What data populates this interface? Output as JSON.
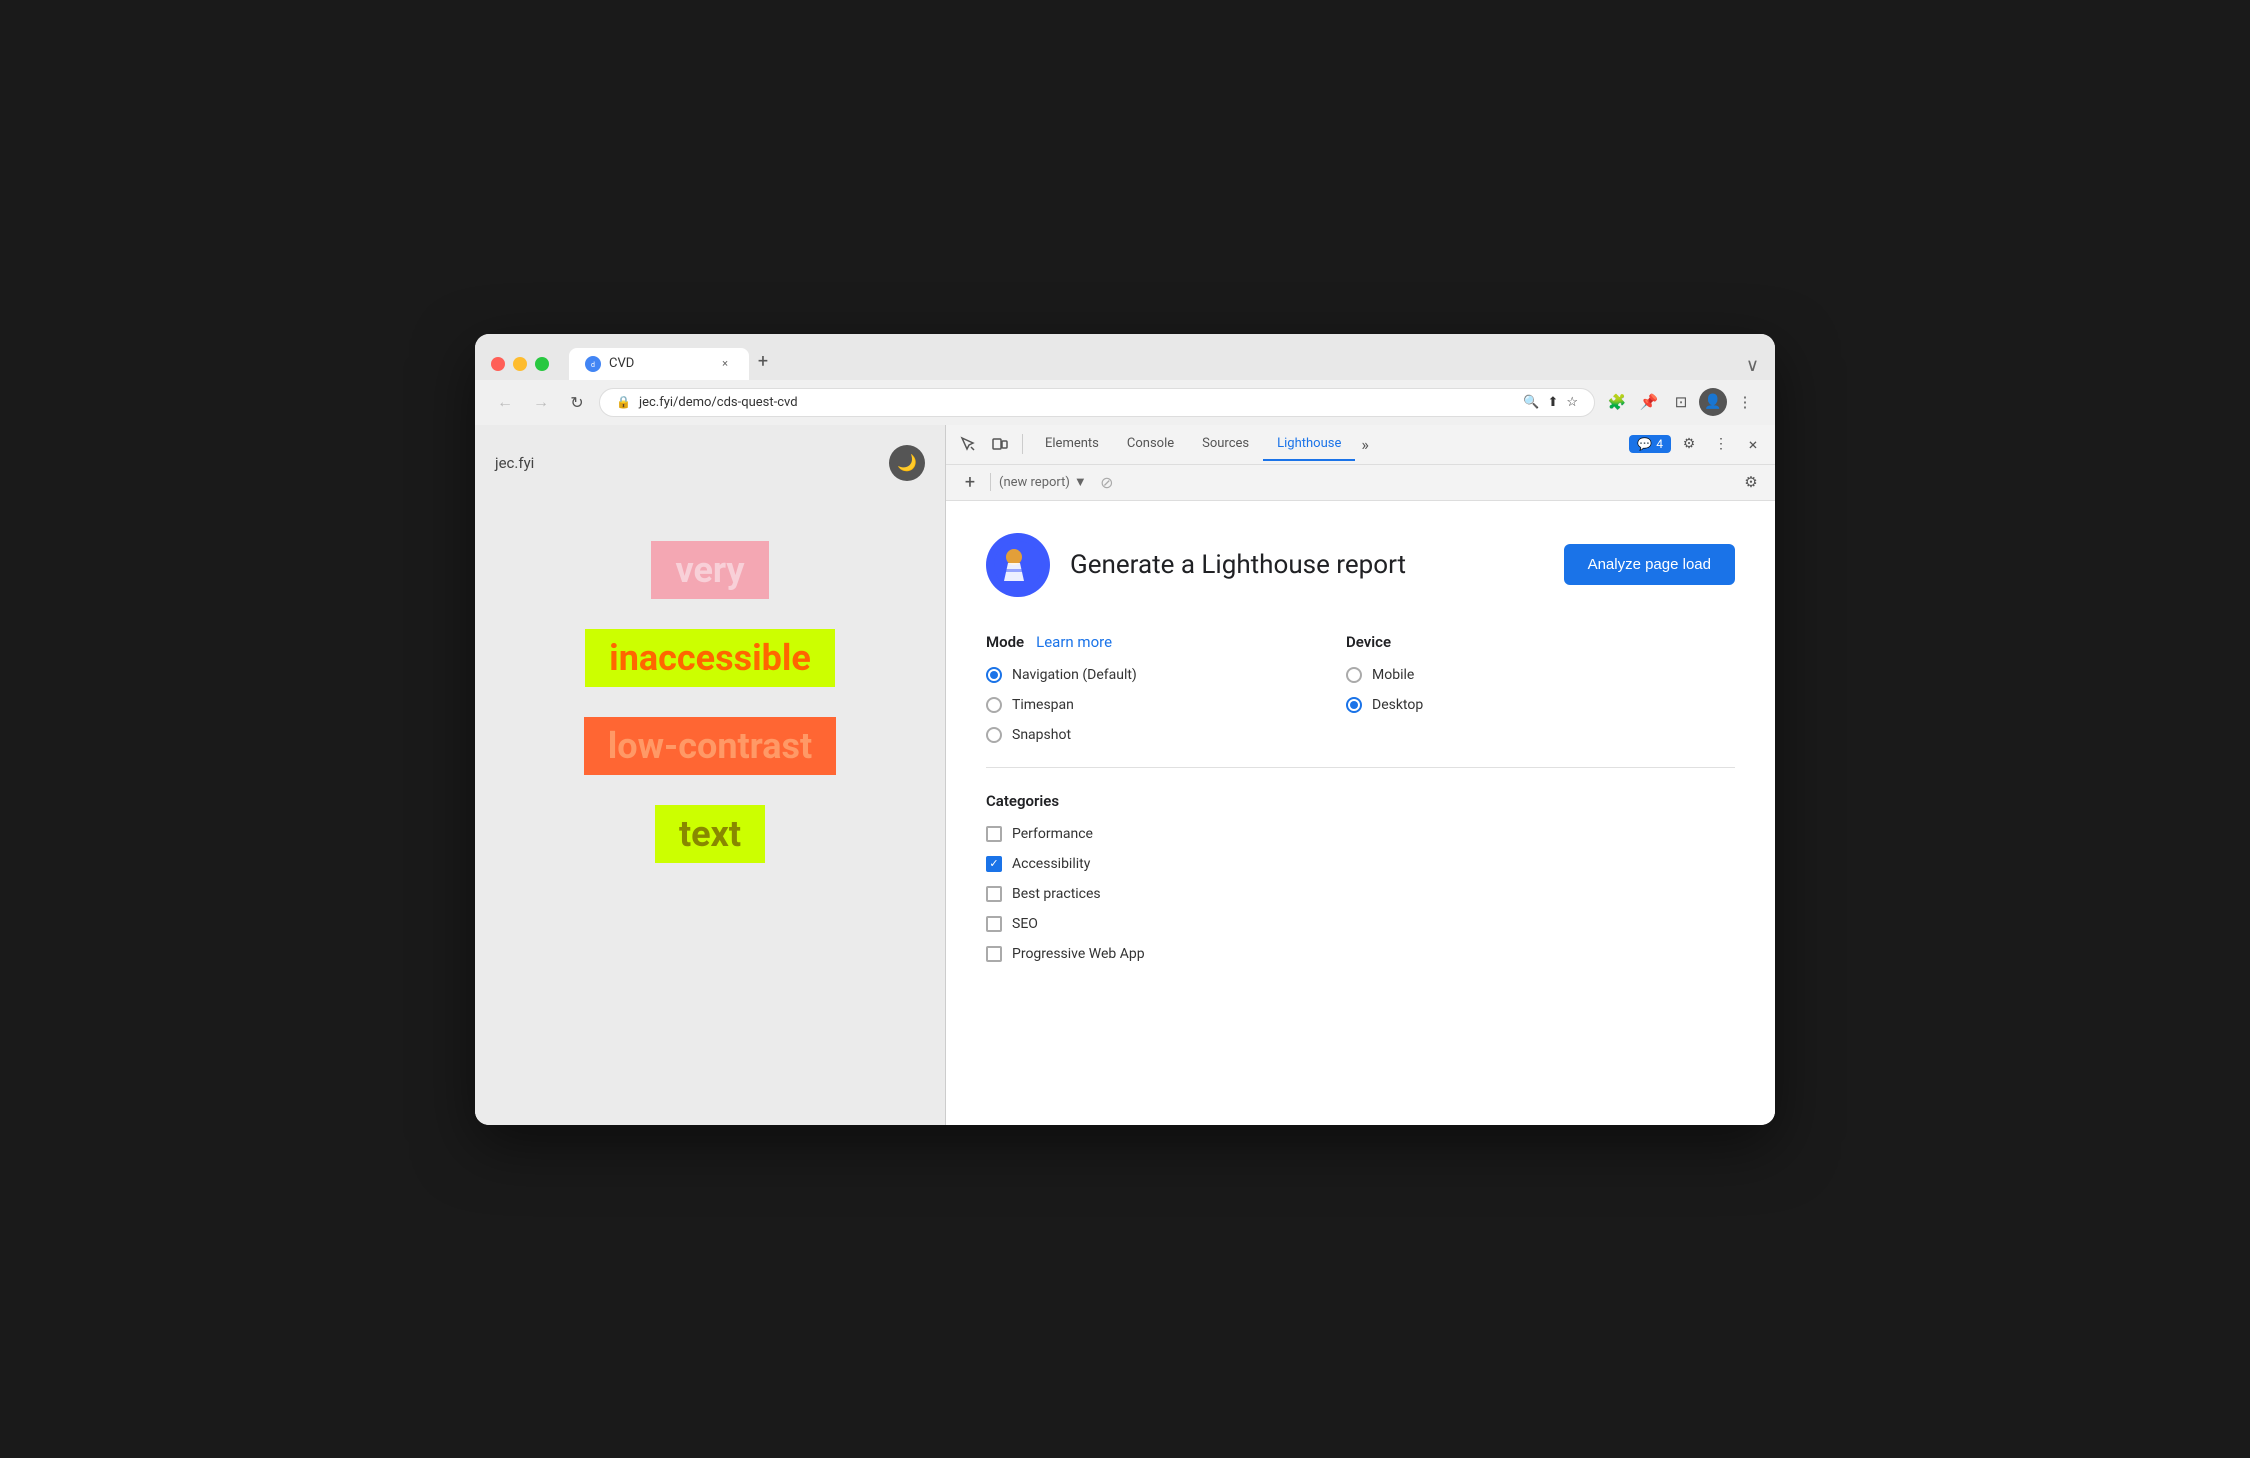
{
  "browser": {
    "tab_title": "CVD",
    "tab_close": "×",
    "new_tab": "+",
    "window_controls_end": "∨",
    "address": "jec.fyi/demo/cds-quest-cvd",
    "back_disabled": true,
    "forward_disabled": true
  },
  "webpage": {
    "logo": "jec.fyi",
    "dark_mode_icon": "🌙",
    "words": [
      {
        "text": "very",
        "bg": "#f4a7b3",
        "color": "#f8c8d0"
      },
      {
        "text": "inaccessible",
        "bg": "#ccff00",
        "color": "#ff6600"
      },
      {
        "text": "low-contrast",
        "bg": "#ff6633",
        "color": "#ff9966"
      },
      {
        "text": "text",
        "bg": "#ccff00",
        "color": "#888800"
      }
    ]
  },
  "devtools": {
    "tabs": [
      {
        "label": "Elements"
      },
      {
        "label": "Console"
      },
      {
        "label": "Sources"
      },
      {
        "label": "Lighthouse",
        "active": true
      }
    ],
    "more_tabs": "»",
    "badge_count": "4",
    "settings_icon": "⚙",
    "more_options": "⋮",
    "close": "×",
    "inspect_icon": "⬚",
    "device_icon": "⊡"
  },
  "lighthouse": {
    "subtoolbar": {
      "add": "+",
      "report_placeholder": "(new report)",
      "dropdown": "▼",
      "block": "⊘",
      "settings": "⚙"
    },
    "header": {
      "title": "Generate a Lighthouse report",
      "analyze_btn": "Analyze page load"
    },
    "mode": {
      "title": "Mode",
      "learn_more": "Learn more",
      "options": [
        {
          "label": "Navigation (Default)",
          "checked": true
        },
        {
          "label": "Timespan",
          "checked": false
        },
        {
          "label": "Snapshot",
          "checked": false
        }
      ]
    },
    "device": {
      "title": "Device",
      "options": [
        {
          "label": "Mobile",
          "checked": false
        },
        {
          "label": "Desktop",
          "checked": true
        }
      ]
    },
    "categories": {
      "title": "Categories",
      "items": [
        {
          "label": "Performance",
          "checked": false
        },
        {
          "label": "Accessibility",
          "checked": true
        },
        {
          "label": "Best practices",
          "checked": false
        },
        {
          "label": "SEO",
          "checked": false
        },
        {
          "label": "Progressive Web App",
          "checked": false
        }
      ]
    }
  }
}
